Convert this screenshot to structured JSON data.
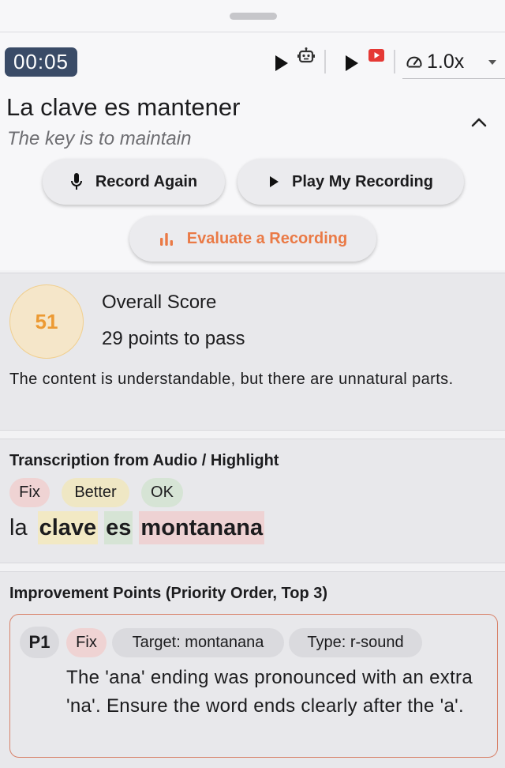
{
  "player": {
    "timer": "00:05",
    "controls": [
      {
        "name": "play-robot-voice",
        "icon": "play-icon",
        "badge_icon": "robot-icon"
      },
      {
        "name": "play-video",
        "icon": "play-icon",
        "badge_icon": "youtube-icon"
      }
    ],
    "speed": "1.0x"
  },
  "phrase": {
    "text": "La clave es mantener",
    "translation": "The key is to maintain"
  },
  "actions": {
    "record_again": "Record Again",
    "play_recording": "Play My Recording",
    "evaluate": "Evaluate a Recording"
  },
  "score": {
    "value": "51",
    "title": "Overall Score",
    "subtitle": "29 points to pass",
    "description": "The content is understandable, but there are unnatural parts."
  },
  "transcription": {
    "title": "Transcription from Audio / Highlight",
    "legend": {
      "fix": "Fix",
      "better": "Better",
      "ok": "OK"
    },
    "words": [
      {
        "text": "la",
        "level": "plain"
      },
      {
        "text": "clave",
        "level": "better"
      },
      {
        "text": "es",
        "level": "ok"
      },
      {
        "text": "montanana",
        "level": "fix"
      }
    ]
  },
  "improvements": {
    "title": "Improvement Points (Priority Order, Top 3)",
    "items": [
      {
        "priority": "P1",
        "level": "Fix",
        "target": "Target: montanana",
        "type": "Type: r-sound",
        "text": "The 'ana' ending was pronounced with an extra 'na'. Ensure the word ends clearly after the 'a'."
      }
    ]
  },
  "colors": {
    "accent_orange": "#ea7a46",
    "timer_bg": "#3a4b67",
    "score_text": "#ec9a33",
    "fix": "#efd3d3",
    "better": "#efe7c4",
    "ok": "#d6e4d5"
  }
}
